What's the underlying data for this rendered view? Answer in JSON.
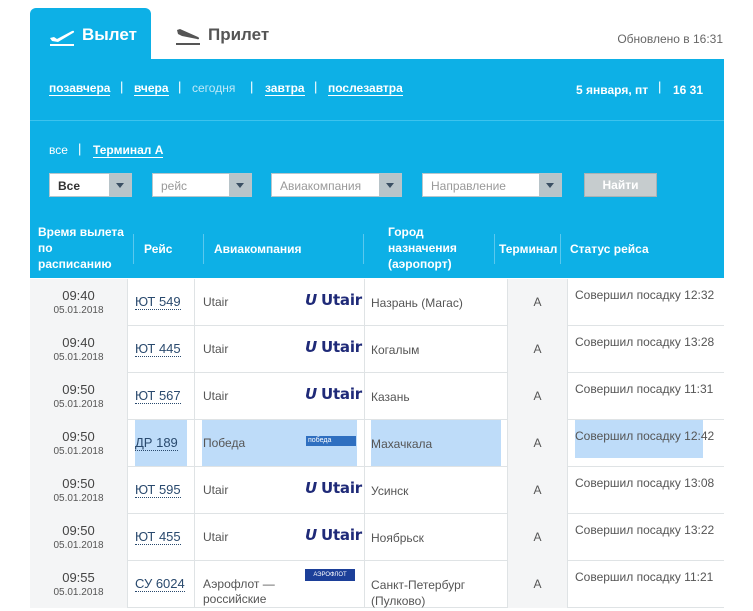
{
  "tabs": {
    "departure_label": "Вылет",
    "arrival_label": "Прилет"
  },
  "updated_text": "Обновлено в 16:31",
  "date_nav": {
    "links": [
      "позавчера",
      "вчера",
      "сегодня",
      "завтра",
      "послезавтра"
    ],
    "current_index": 2,
    "current_date": "5 января, пт",
    "current_time": "16 31"
  },
  "terminal_filter": {
    "links": [
      "все",
      "Терминал А"
    ],
    "selected_index": 1
  },
  "filters": {
    "terminal_select": "Все",
    "flight_placeholder": "рейс",
    "airline_placeholder": "Авиакомпания",
    "direction_placeholder": "Направление",
    "find_button": "Найти"
  },
  "table": {
    "headers": [
      "Время вылета по расписанию",
      "Рейс",
      "Авиакомпания",
      "Город назначения (аэропорт)",
      "Терминал",
      "Статус рейса"
    ],
    "rows": [
      {
        "time": "09:40",
        "date": "05.01.2018",
        "flight": "ЮТ 549",
        "airline": "Utair",
        "logo": "Utair",
        "city": "Назрань (Магас)",
        "terminal": "A",
        "status": "Совершил посадку 12:32"
      },
      {
        "time": "09:40",
        "date": "05.01.2018",
        "flight": "ЮТ 445",
        "airline": "Utair",
        "logo": "Utair",
        "city": "Когалым",
        "terminal": "A",
        "status": "Совершил посадку 13:28"
      },
      {
        "time": "09:50",
        "date": "05.01.2018",
        "flight": "ЮТ 567",
        "airline": "Utair",
        "logo": "Utair",
        "city": "Казань",
        "terminal": "A",
        "status": "Совершил посадку 11:31"
      },
      {
        "time": "09:50",
        "date": "05.01.2018",
        "flight": "ДР 189",
        "airline": "Победа",
        "logo": "победа",
        "city": "Махачкала",
        "terminal": "A",
        "status": "Совершил посадку 12:42"
      },
      {
        "time": "09:50",
        "date": "05.01.2018",
        "flight": "ЮТ 595",
        "airline": "Utair",
        "logo": "Utair",
        "city": "Усинск",
        "terminal": "A",
        "status": "Совершил посадку 13:08"
      },
      {
        "time": "09:50",
        "date": "05.01.2018",
        "flight": "ЮТ 455",
        "airline": "Utair",
        "logo": "Utair",
        "city": "Ноябрьск",
        "terminal": "A",
        "status": "Совершил посадку 13:22"
      },
      {
        "time": "09:55",
        "date": "05.01.2018",
        "flight": "СУ 6024",
        "airline": "Аэрофлот — российские авиалинии",
        "logo": "АЭРОФЛОТ",
        "city": "Санкт-Петербург (Пулково)",
        "terminal": "A",
        "status": "Совершил посадку 11:21"
      }
    ]
  },
  "colors": {
    "panel_blue": "#0db0e6",
    "selection_highlight": "#a8d0f7",
    "utair_logo": "#1f2a78"
  }
}
